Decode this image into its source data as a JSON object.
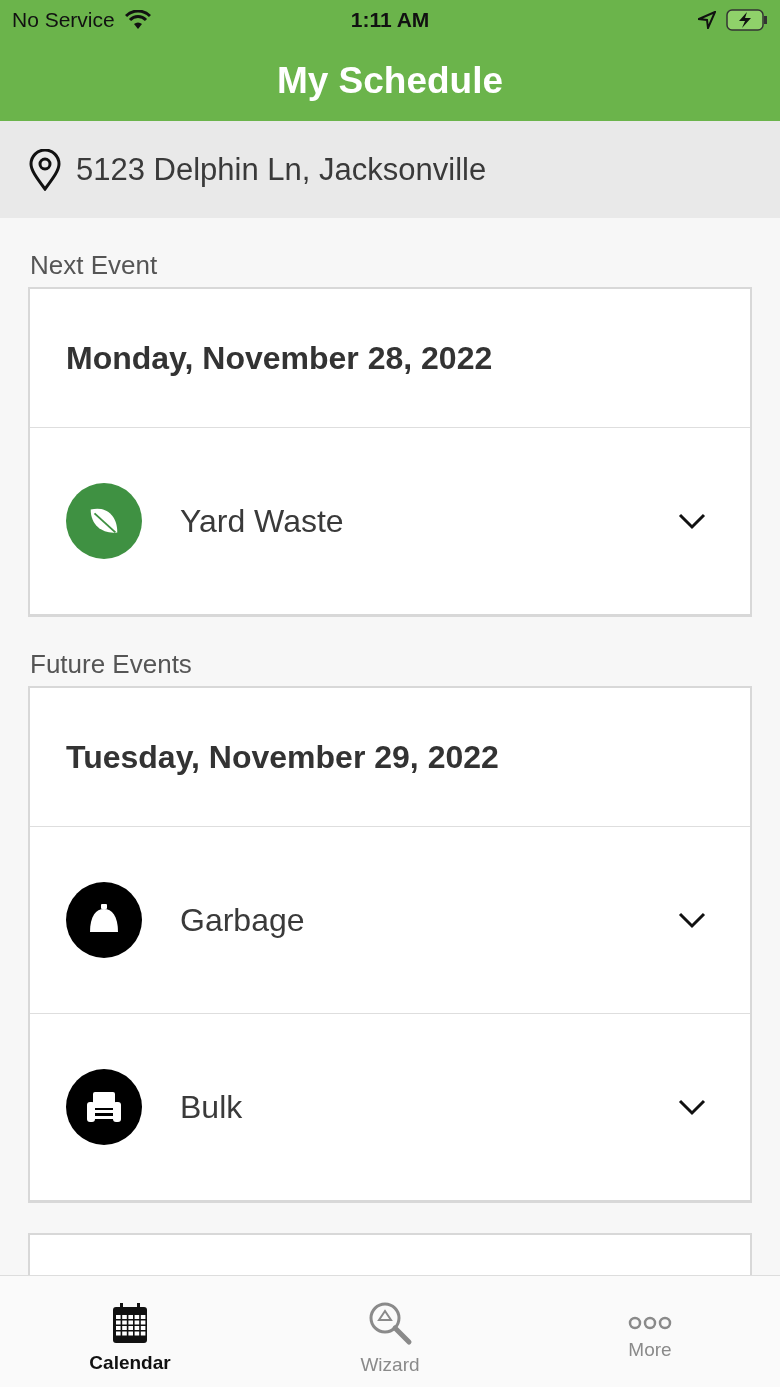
{
  "status_bar": {
    "carrier": "No Service",
    "time": "1:11 AM"
  },
  "header": {
    "title": "My Schedule"
  },
  "address": "5123 Delphin Ln, Jacksonville",
  "next_event": {
    "label": "Next Event",
    "date": "Monday, November 28, 2022",
    "items": [
      {
        "name": "Yard Waste",
        "kind": "leaf",
        "color": "#3f9142",
        "expanded": false
      }
    ]
  },
  "future_events": {
    "label": "Future Events",
    "date": "Tuesday, November 29, 2022",
    "items": [
      {
        "name": "Garbage",
        "kind": "bell",
        "color": "#000000",
        "expanded": false
      },
      {
        "name": "Bulk",
        "kind": "chair",
        "color": "#000000",
        "expanded": false
      }
    ]
  },
  "tabs": [
    {
      "label": "Calendar",
      "kind": "calendar",
      "selected": true
    },
    {
      "label": "Wizard",
      "kind": "wizard",
      "selected": false
    },
    {
      "label": "More",
      "kind": "more",
      "selected": false
    }
  ]
}
